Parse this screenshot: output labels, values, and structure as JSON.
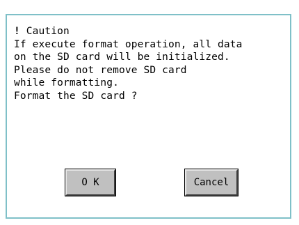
{
  "dialog": {
    "caution_mark": "!",
    "caution_title": "Caution",
    "lines": [
      "If execute format operation, all data",
      "on the SD card will be initialized.",
      "Please do not remove SD card",
      "while formatting.",
      "Format the SD card ?"
    ]
  },
  "buttons": {
    "ok_label": "O K",
    "cancel_label": "Cancel"
  },
  "colors": {
    "dialog_border": "#7fc0c8",
    "button_face": "#c0c0c0"
  }
}
